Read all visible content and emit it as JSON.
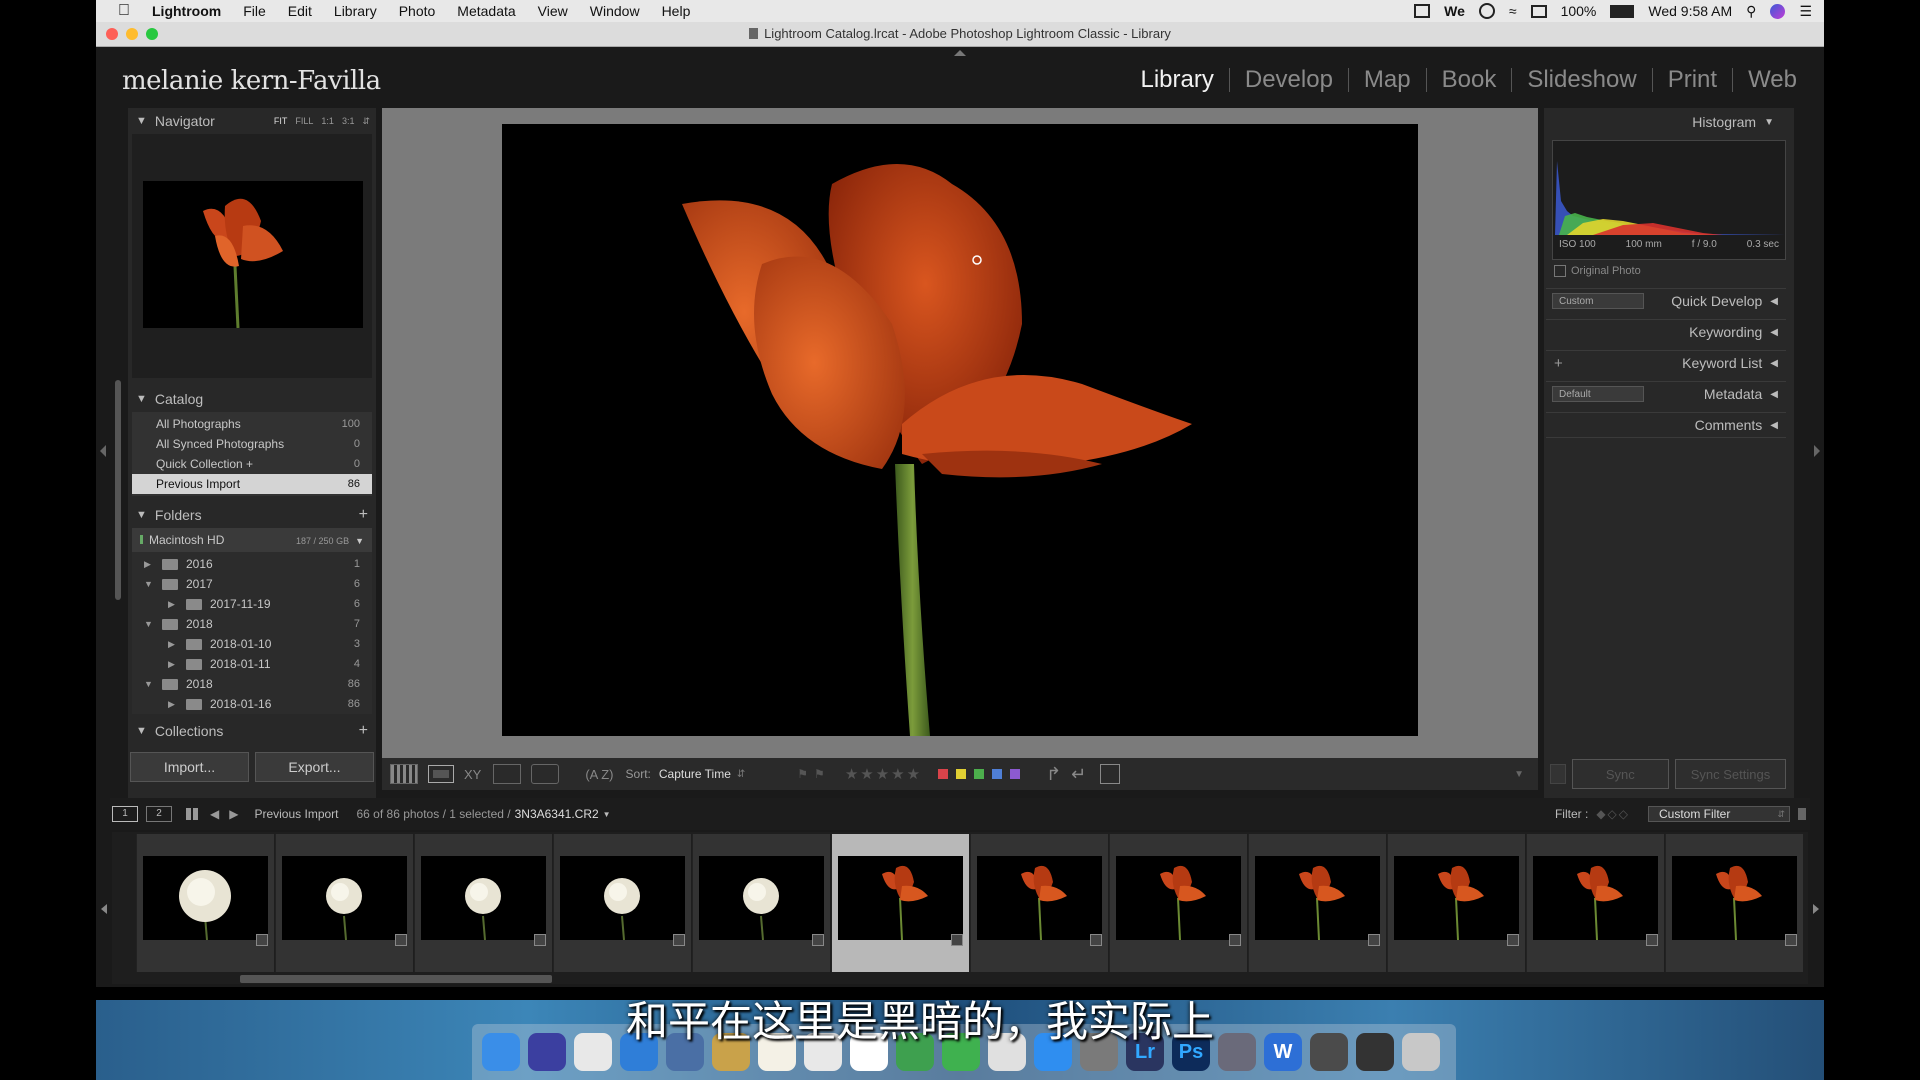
{
  "menubar": {
    "app": "Lightroom",
    "items": [
      "File",
      "Edit",
      "Library",
      "Photo",
      "Metadata",
      "View",
      "Window",
      "Help"
    ],
    "battery": "100%",
    "clock": "Wed 9:58 AM"
  },
  "window_title": "Lightroom Catalog.lrcat - Adobe Photoshop Lightroom Classic - Library",
  "identity_plate": "melanie kern-Favilla",
  "modules": [
    "Library",
    "Develop",
    "Map",
    "Book",
    "Slideshow",
    "Print",
    "Web"
  ],
  "navigator": {
    "title": "Navigator",
    "options": [
      "FIT",
      "FILL",
      "1:1",
      "3:1"
    ]
  },
  "catalog": {
    "title": "Catalog",
    "items": [
      {
        "label": "All Photographs",
        "count": "100"
      },
      {
        "label": "All Synced Photographs",
        "count": "0"
      },
      {
        "label": "Quick Collection +",
        "count": "0"
      },
      {
        "label": "Previous Import",
        "count": "86"
      }
    ]
  },
  "folders": {
    "title": "Folders",
    "volume": {
      "label": "Macintosh HD",
      "size": "187 / 250 GB"
    },
    "items": [
      {
        "label": "2016",
        "count": "1",
        "level": 0,
        "open": false
      },
      {
        "label": "2017",
        "count": "6",
        "level": 0,
        "open": true
      },
      {
        "label": "2017-11-19",
        "count": "6",
        "level": 1,
        "open": false
      },
      {
        "label": "2018",
        "count": "7",
        "level": 0,
        "open": true
      },
      {
        "label": "2018-01-10",
        "count": "3",
        "level": 1,
        "open": false
      },
      {
        "label": "2018-01-11",
        "count": "4",
        "level": 1,
        "open": false
      },
      {
        "label": "2018",
        "count": "86",
        "level": 0,
        "open": true
      },
      {
        "label": "2018-01-16",
        "count": "86",
        "level": 1,
        "open": false
      }
    ]
  },
  "collections": {
    "title": "Collections"
  },
  "buttons": {
    "import": "Import...",
    "export": "Export..."
  },
  "toolbar": {
    "sort_label": "Sort:",
    "sort_value": "Capture Time",
    "colors": [
      "#d9434a",
      "#e0cf33",
      "#4cae4c",
      "#4f7fd6",
      "#8c5ad0"
    ]
  },
  "histogram": {
    "title": "Histogram",
    "iso": "ISO 100",
    "focal": "100 mm",
    "aperture": "f / 9.0",
    "shutter": "0.3 sec",
    "original_photo": "Original Photo"
  },
  "right_panels": {
    "quick_develop": "Quick Develop",
    "qd_preset": "Custom",
    "keywording": "Keywording",
    "keyword_list": "Keyword List",
    "metadata": "Metadata",
    "md_preset": "Default",
    "comments": "Comments",
    "sync": "Sync",
    "sync_settings": "Sync Settings"
  },
  "filmstrip_bar": {
    "source": "Previous Import",
    "info": "66 of 86 photos / 1 selected /",
    "filename": "3N3A6341.CR2",
    "filter_label": "Filter :",
    "filter_value": "Custom Filter",
    "pages": [
      "1",
      "2"
    ]
  },
  "subtitle": "和平在这里是黑暗的，我实际上",
  "dock_apps": [
    "finder-icon",
    "siri-icon",
    "chrome-icon",
    "safari-icon",
    "preview-icon",
    "notes-icon",
    "pages-icon",
    "files-icon",
    "photos-icon",
    "messages-icon",
    "facetime-icon",
    "itunes-icon",
    "appstore-icon",
    "settings-icon",
    "Lr",
    "Ps",
    "launchpad-icon",
    "W",
    "downloads-icon",
    "screen-icon",
    "trash-icon"
  ]
}
